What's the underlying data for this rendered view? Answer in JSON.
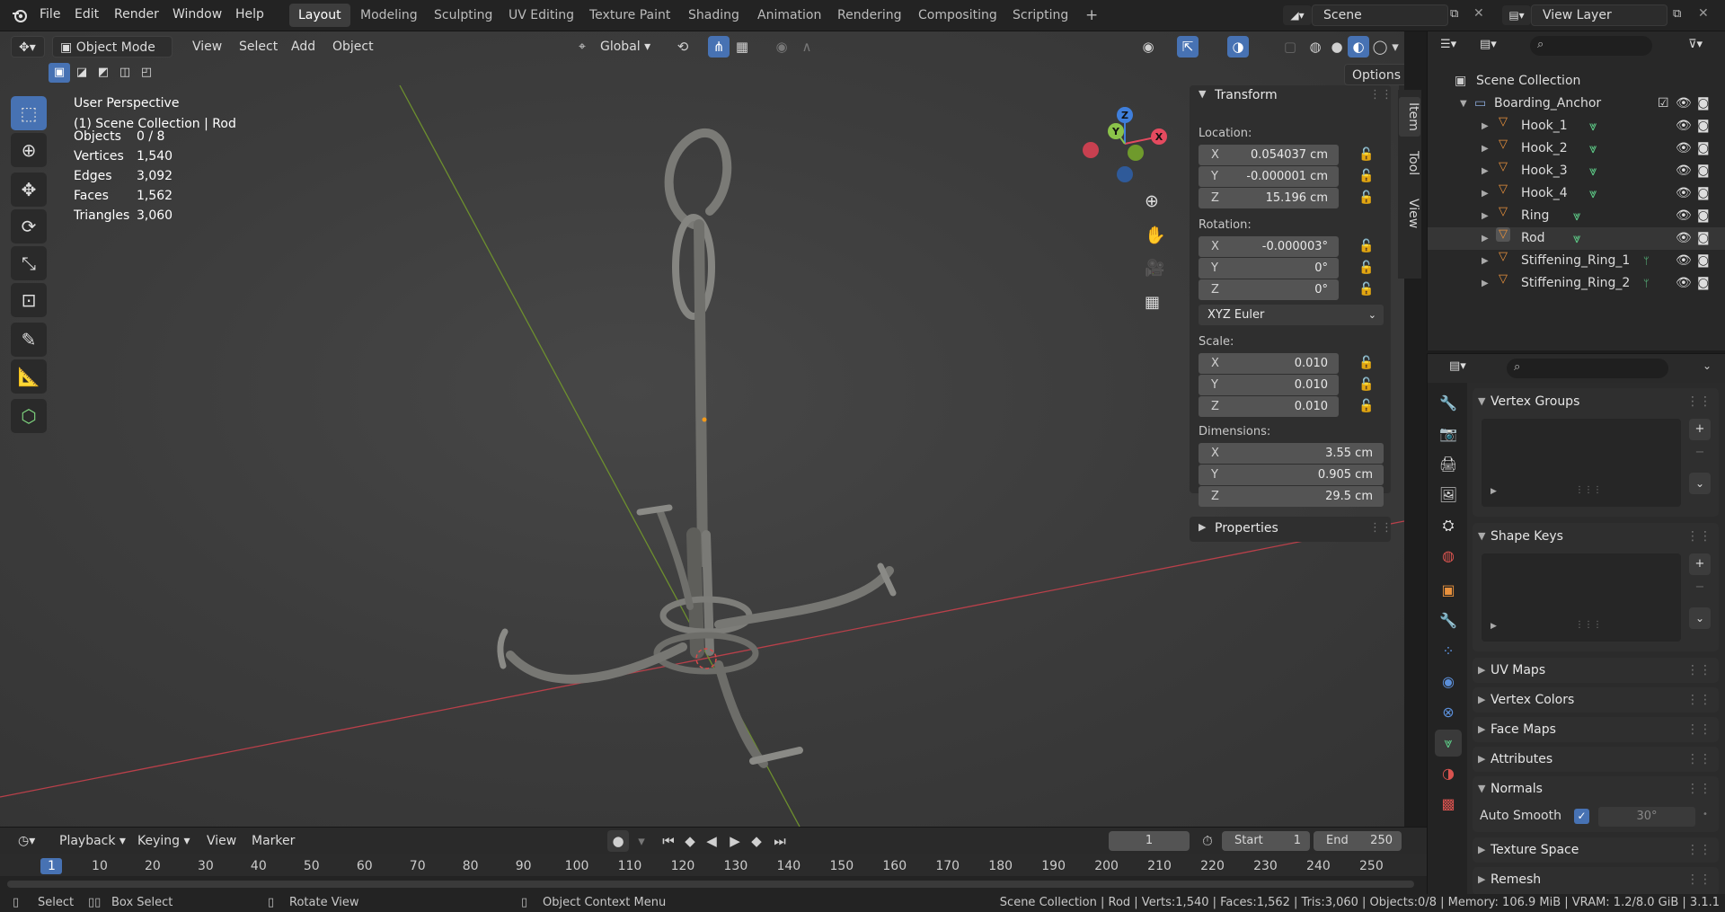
{
  "topbar": {
    "menus": [
      "File",
      "Edit",
      "Render",
      "Window",
      "Help"
    ],
    "workspaces": [
      "Layout",
      "Modeling",
      "Sculpting",
      "UV Editing",
      "Texture Paint",
      "Shading",
      "Animation",
      "Rendering",
      "Compositing",
      "Scripting"
    ],
    "active_workspace": "Layout",
    "add_tab": "+",
    "scene": "Scene",
    "view_layer": "View Layer"
  },
  "viewport": {
    "mode": "Object Mode",
    "menus": [
      "View",
      "Select",
      "Add",
      "Object"
    ],
    "transform_orientation": "Global",
    "options": "Options",
    "perspective": "User Perspective",
    "collection_info": "(1) Scene Collection | Rod",
    "stats": [
      {
        "label": "Objects",
        "value": "0 / 8"
      },
      {
        "label": "Vertices",
        "value": "1,540"
      },
      {
        "label": "Edges",
        "value": "3,092"
      },
      {
        "label": "Faces",
        "value": "1,562"
      },
      {
        "label": "Triangles",
        "value": "3,060"
      }
    ],
    "gizmo_axes": {
      "x": "X",
      "y": "Y",
      "z": "Z"
    }
  },
  "npanel": {
    "tabs": [
      "Item",
      "Tool",
      "View"
    ],
    "transform_title": "Transform",
    "location_label": "Location:",
    "location": [
      {
        "axis": "X",
        "value": "0.054037 cm"
      },
      {
        "axis": "Y",
        "value": "-0.000001 cm"
      },
      {
        "axis": "Z",
        "value": "15.196 cm"
      }
    ],
    "rotation_label": "Rotation:",
    "rotation": [
      {
        "axis": "X",
        "value": "-0.000003°"
      },
      {
        "axis": "Y",
        "value": "0°"
      },
      {
        "axis": "Z",
        "value": "0°"
      }
    ],
    "rotation_mode": "XYZ Euler",
    "scale_label": "Scale:",
    "scale": [
      {
        "axis": "X",
        "value": "0.010"
      },
      {
        "axis": "Y",
        "value": "0.010"
      },
      {
        "axis": "Z",
        "value": "0.010"
      }
    ],
    "dimensions_label": "Dimensions:",
    "dimensions": [
      {
        "axis": "X",
        "value": "3.55 cm"
      },
      {
        "axis": "Y",
        "value": "0.905 cm"
      },
      {
        "axis": "Z",
        "value": "29.5 cm"
      }
    ],
    "properties_title": "Properties"
  },
  "outliner": {
    "root": "Scene Collection",
    "collection": "Boarding_Anchor",
    "items": [
      "Hook_1",
      "Hook_2",
      "Hook_3",
      "Hook_4",
      "Ring",
      "Rod",
      "Stiffening_Ring_1",
      "Stiffening_Ring_2"
    ],
    "selected": "Rod"
  },
  "properties": {
    "panels": {
      "vertex_groups": "Vertex Groups",
      "shape_keys": "Shape Keys",
      "uv_maps": "UV Maps",
      "vertex_colors": "Vertex Colors",
      "face_maps": "Face Maps",
      "attributes": "Attributes",
      "normals": "Normals",
      "texture_space": "Texture Space",
      "remesh": "Remesh"
    },
    "auto_smooth_label": "Auto Smooth",
    "auto_smooth_angle": "30°"
  },
  "timeline": {
    "menus": [
      "Playback",
      "Keying",
      "View",
      "Marker"
    ],
    "current_frame": "1",
    "start_label": "Start",
    "start": "1",
    "end_label": "End",
    "end": "250",
    "ruler": [
      "1",
      "10",
      "20",
      "30",
      "40",
      "50",
      "60",
      "70",
      "80",
      "90",
      "100",
      "110",
      "120",
      "130",
      "140",
      "150",
      "160",
      "170",
      "180",
      "190",
      "200",
      "210",
      "220",
      "230",
      "240",
      "250"
    ]
  },
  "statusbar": {
    "select": "Select",
    "box_select": "Box Select",
    "rotate_view": "Rotate View",
    "context_menu": "Object Context Menu",
    "info": "Scene Collection | Rod | Verts:1,540 | Faces:1,562 | Tris:3,060 | Objects:0/8 | Memory: 106.9 MiB | VRAM: 1.2/8.0 GiB | 3.1.1"
  },
  "colors": {
    "accent": "#4772b3",
    "x_axis": "#e44a5f",
    "y_axis": "#8bc34a",
    "z_axis": "#3f7fdc",
    "object_icon": "#e8913d",
    "mesh_icon": "#5fd08a"
  }
}
